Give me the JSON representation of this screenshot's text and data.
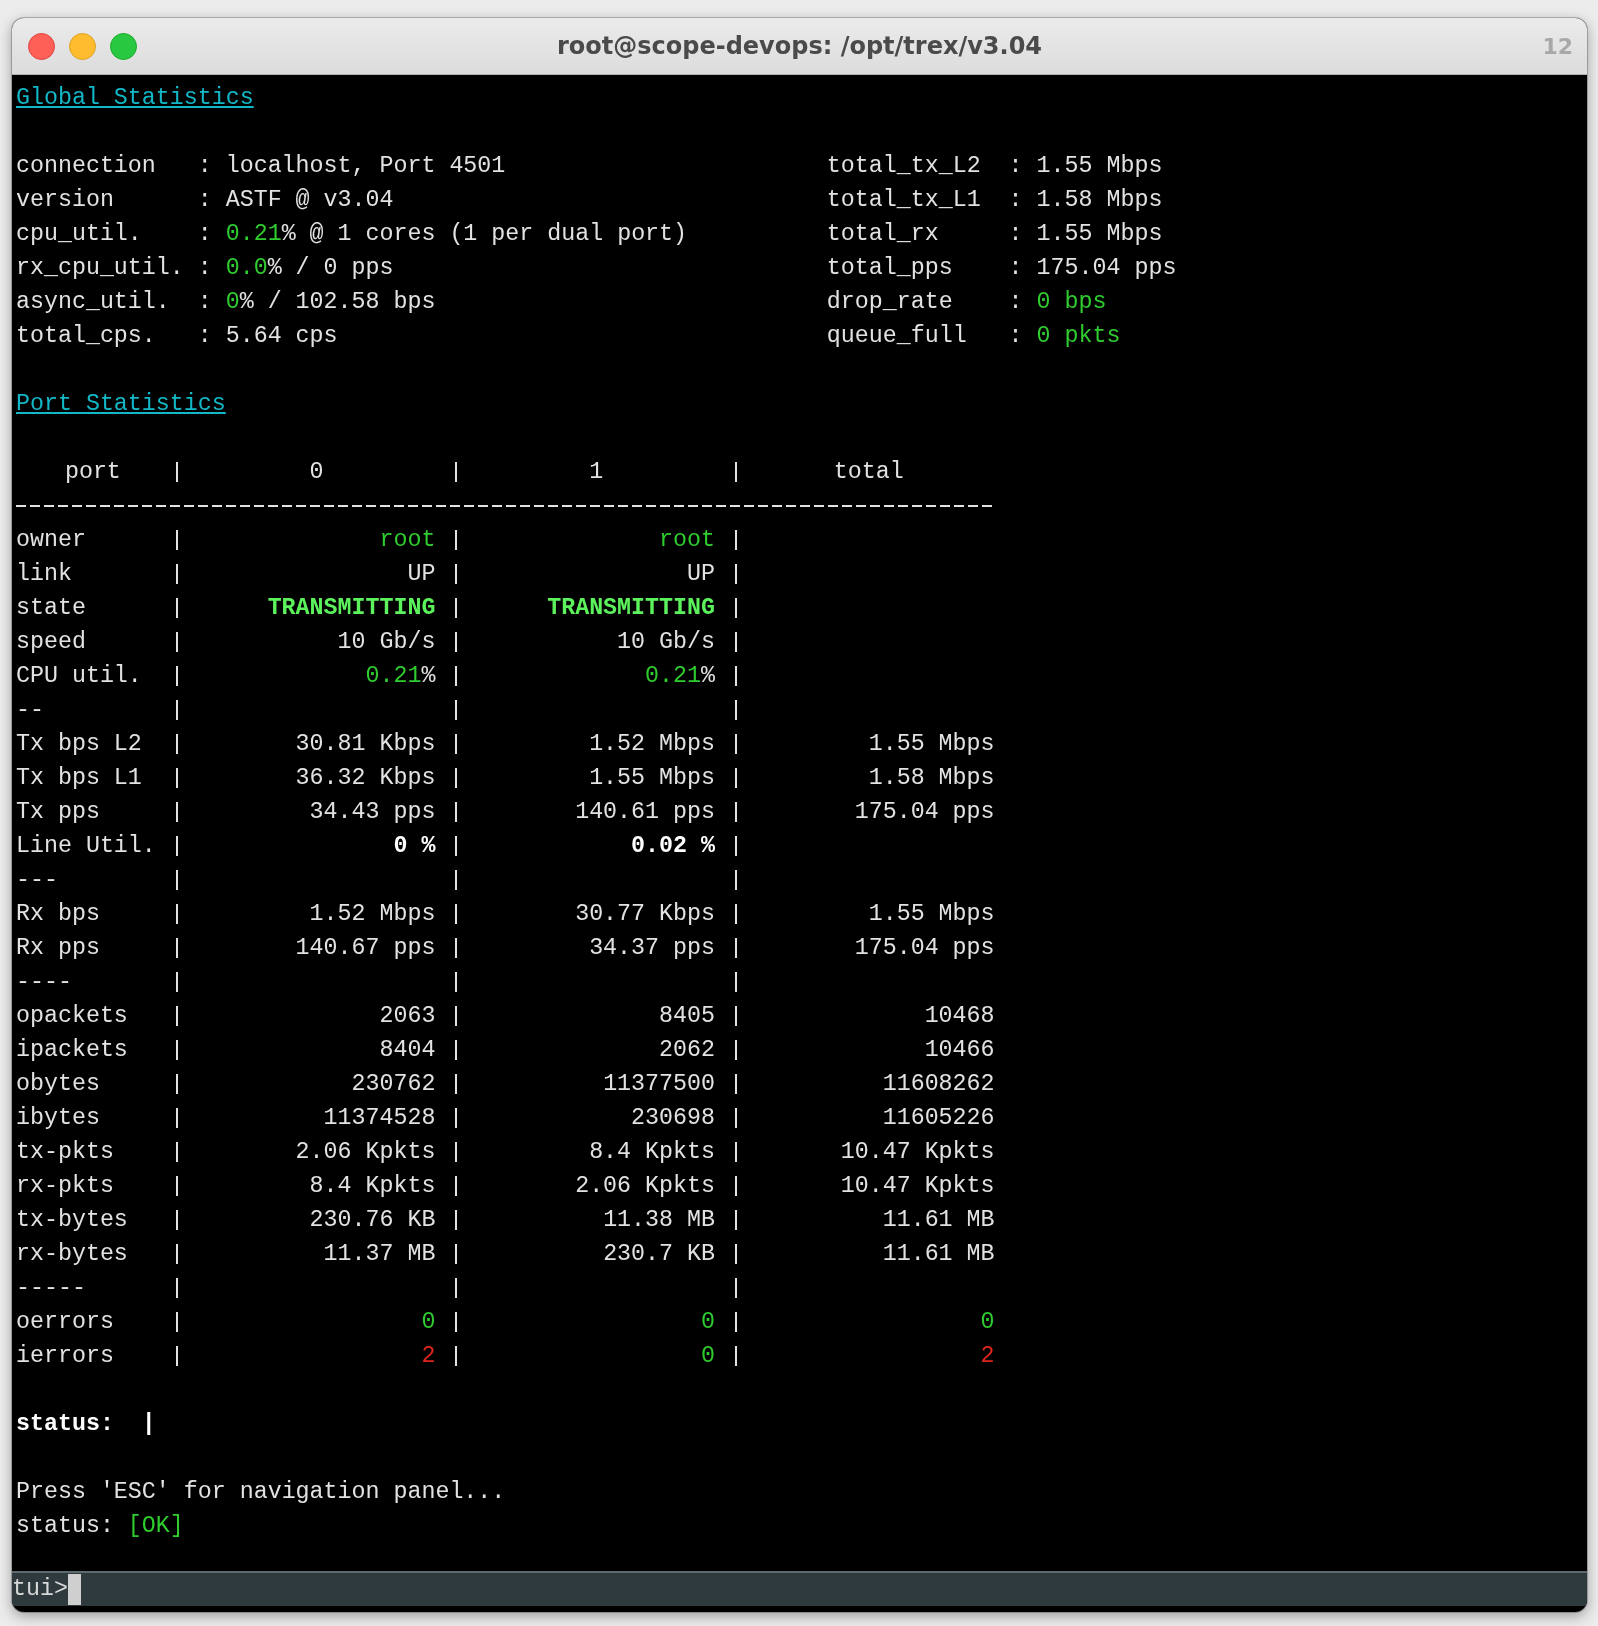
{
  "window": {
    "title": "root@scope-devops: /opt/trex/v3.04",
    "number": "12"
  },
  "global_statistics": {
    "title": "Global Statistics",
    "left": [
      {
        "label": "connection",
        "value": [
          {
            "text": ": localhost, Port 4501",
            "kind": "normal"
          }
        ]
      },
      {
        "label": "version",
        "value": [
          {
            "text": ": ASTF @ v3.04",
            "kind": "normal"
          }
        ]
      },
      {
        "label": "cpu_util.",
        "value": [
          {
            "text": ": ",
            "kind": "normal"
          },
          {
            "text": "0.21",
            "kind": "green"
          },
          {
            "text": "% @ 1 cores (1 per dual port)",
            "kind": "normal"
          }
        ]
      },
      {
        "label": "rx_cpu_util.",
        "value": [
          {
            "text": ": ",
            "kind": "normal"
          },
          {
            "text": "0.0",
            "kind": "green"
          },
          {
            "text": "% / 0 pps",
            "kind": "normal"
          }
        ]
      },
      {
        "label": "async_util.",
        "value": [
          {
            "text": ": ",
            "kind": "normal"
          },
          {
            "text": "0",
            "kind": "green"
          },
          {
            "text": "% / 102.58 bps",
            "kind": "normal"
          }
        ]
      },
      {
        "label": "total_cps.",
        "value": [
          {
            "text": ": 5.64 cps",
            "kind": "normal"
          }
        ]
      }
    ],
    "right": [
      {
        "label": "total_tx_L2",
        "value": [
          {
            "text": ": 1.55 Mbps",
            "kind": "normal"
          }
        ]
      },
      {
        "label": "total_tx_L1",
        "value": [
          {
            "text": ": 1.58 Mbps",
            "kind": "normal"
          }
        ]
      },
      {
        "label": "total_rx",
        "value": [
          {
            "text": ": 1.55 Mbps",
            "kind": "normal"
          }
        ]
      },
      {
        "label": "total_pps",
        "value": [
          {
            "text": ": 175.04 pps",
            "kind": "normal"
          }
        ]
      },
      {
        "label": "drop_rate",
        "value": [
          {
            "text": ": ",
            "kind": "normal"
          },
          {
            "text": "0 bps",
            "kind": "green"
          }
        ]
      },
      {
        "label": "queue_full",
        "value": [
          {
            "text": ": ",
            "kind": "normal"
          },
          {
            "text": "0 pkts",
            "kind": "green"
          }
        ]
      }
    ]
  },
  "port_statistics": {
    "title": "Port Statistics",
    "columns": [
      "port",
      "0",
      "1",
      "total"
    ],
    "rows": [
      {
        "label": "owner",
        "cells": [
          [
            {
              "text": "root",
              "kind": "green"
            }
          ],
          [
            {
              "text": "root",
              "kind": "green"
            }
          ]
        ]
      },
      {
        "label": "link",
        "cells": [
          [
            {
              "text": "UP",
              "kind": "normal"
            }
          ],
          [
            {
              "text": "UP",
              "kind": "normal"
            }
          ]
        ]
      },
      {
        "label": "state",
        "cells": [
          [
            {
              "text": "TRANSMITTING",
              "kind": "bright-green-bold"
            }
          ],
          [
            {
              "text": "TRANSMITTING",
              "kind": "bright-green-bold"
            }
          ]
        ]
      },
      {
        "label": "speed",
        "cells": [
          [
            {
              "text": "10 Gb/s",
              "kind": "normal"
            }
          ],
          [
            {
              "text": "10 Gb/s",
              "kind": "normal"
            }
          ]
        ]
      },
      {
        "label": "CPU util.",
        "cells": [
          [
            {
              "text": "0.21",
              "kind": "green"
            },
            {
              "text": "%",
              "kind": "normal"
            }
          ],
          [
            {
              "text": "0.21",
              "kind": "green"
            },
            {
              "text": "%",
              "kind": "normal"
            }
          ]
        ]
      },
      {
        "label": "--",
        "cells": []
      },
      {
        "label": "Tx bps L2",
        "cells": [
          [
            {
              "text": "30.81 Kbps",
              "kind": "normal"
            }
          ],
          [
            {
              "text": "1.52 Mbps",
              "kind": "normal"
            }
          ],
          [
            {
              "text": "1.55 Mbps",
              "kind": "normal"
            }
          ]
        ]
      },
      {
        "label": "Tx bps L1",
        "cells": [
          [
            {
              "text": "36.32 Kbps",
              "kind": "normal"
            }
          ],
          [
            {
              "text": "1.55 Mbps",
              "kind": "normal"
            }
          ],
          [
            {
              "text": "1.58 Mbps",
              "kind": "normal"
            }
          ]
        ]
      },
      {
        "label": "Tx pps",
        "cells": [
          [
            {
              "text": "34.43 pps",
              "kind": "normal"
            }
          ],
          [
            {
              "text": "140.61 pps",
              "kind": "normal"
            }
          ],
          [
            {
              "text": "175.04 pps",
              "kind": "normal"
            }
          ]
        ]
      },
      {
        "label": "Line Util.",
        "cells": [
          [
            {
              "text": "0 %",
              "kind": "bold"
            }
          ],
          [
            {
              "text": "0.02 %",
              "kind": "bold"
            }
          ]
        ]
      },
      {
        "label": "---",
        "cells": []
      },
      {
        "label": "Rx bps",
        "cells": [
          [
            {
              "text": "1.52 Mbps",
              "kind": "normal"
            }
          ],
          [
            {
              "text": "30.77 Kbps",
              "kind": "normal"
            }
          ],
          [
            {
              "text": "1.55 Mbps",
              "kind": "normal"
            }
          ]
        ]
      },
      {
        "label": "Rx pps",
        "cells": [
          [
            {
              "text": "140.67 pps",
              "kind": "normal"
            }
          ],
          [
            {
              "text": "34.37 pps",
              "kind": "normal"
            }
          ],
          [
            {
              "text": "175.04 pps",
              "kind": "normal"
            }
          ]
        ]
      },
      {
        "label": "----",
        "cells": []
      },
      {
        "label": "opackets",
        "cells": [
          [
            {
              "text": "2063",
              "kind": "normal"
            }
          ],
          [
            {
              "text": "8405",
              "kind": "normal"
            }
          ],
          [
            {
              "text": "10468",
              "kind": "normal"
            }
          ]
        ]
      },
      {
        "label": "ipackets",
        "cells": [
          [
            {
              "text": "8404",
              "kind": "normal"
            }
          ],
          [
            {
              "text": "2062",
              "kind": "normal"
            }
          ],
          [
            {
              "text": "10466",
              "kind": "normal"
            }
          ]
        ]
      },
      {
        "label": "obytes",
        "cells": [
          [
            {
              "text": "230762",
              "kind": "normal"
            }
          ],
          [
            {
              "text": "11377500",
              "kind": "normal"
            }
          ],
          [
            {
              "text": "11608262",
              "kind": "normal"
            }
          ]
        ]
      },
      {
        "label": "ibytes",
        "cells": [
          [
            {
              "text": "11374528",
              "kind": "normal"
            }
          ],
          [
            {
              "text": "230698",
              "kind": "normal"
            }
          ],
          [
            {
              "text": "11605226",
              "kind": "normal"
            }
          ]
        ]
      },
      {
        "label": "tx-pkts",
        "cells": [
          [
            {
              "text": "2.06 Kpkts",
              "kind": "normal"
            }
          ],
          [
            {
              "text": "8.4 Kpkts",
              "kind": "normal"
            }
          ],
          [
            {
              "text": "10.47 Kpkts",
              "kind": "normal"
            }
          ]
        ]
      },
      {
        "label": "rx-pkts",
        "cells": [
          [
            {
              "text": "8.4 Kpkts",
              "kind": "normal"
            }
          ],
          [
            {
              "text": "2.06 Kpkts",
              "kind": "normal"
            }
          ],
          [
            {
              "text": "10.47 Kpkts",
              "kind": "normal"
            }
          ]
        ]
      },
      {
        "label": "tx-bytes",
        "cells": [
          [
            {
              "text": "230.76 KB",
              "kind": "normal"
            }
          ],
          [
            {
              "text": "11.38 MB",
              "kind": "normal"
            }
          ],
          [
            {
              "text": "11.61 MB",
              "kind": "normal"
            }
          ]
        ]
      },
      {
        "label": "rx-bytes",
        "cells": [
          [
            {
              "text": "11.37 MB",
              "kind": "normal"
            }
          ],
          [
            {
              "text": "230.7 KB",
              "kind": "normal"
            }
          ],
          [
            {
              "text": "11.61 MB",
              "kind": "normal"
            }
          ]
        ]
      },
      {
        "label": "-----",
        "cells": []
      },
      {
        "label": "oerrors",
        "cells": [
          [
            {
              "text": "0",
              "kind": "green"
            }
          ],
          [
            {
              "text": "0",
              "kind": "green"
            }
          ],
          [
            {
              "text": "0",
              "kind": "green"
            }
          ]
        ]
      },
      {
        "label": "ierrors",
        "cells": [
          [
            {
              "text": "2",
              "kind": "red"
            }
          ],
          [
            {
              "text": "0",
              "kind": "green"
            }
          ],
          [
            {
              "text": "2",
              "kind": "red"
            }
          ]
        ]
      }
    ]
  },
  "status": {
    "label": "status:",
    "spinner": "|"
  },
  "messages": [
    [
      {
        "text": "Press 'ESC' for navigation panel...",
        "kind": "normal"
      }
    ],
    [
      {
        "text": "status: ",
        "kind": "normal"
      },
      {
        "text": "[OK]",
        "kind": "green"
      }
    ]
  ],
  "prompt": {
    "text": "tui>"
  }
}
